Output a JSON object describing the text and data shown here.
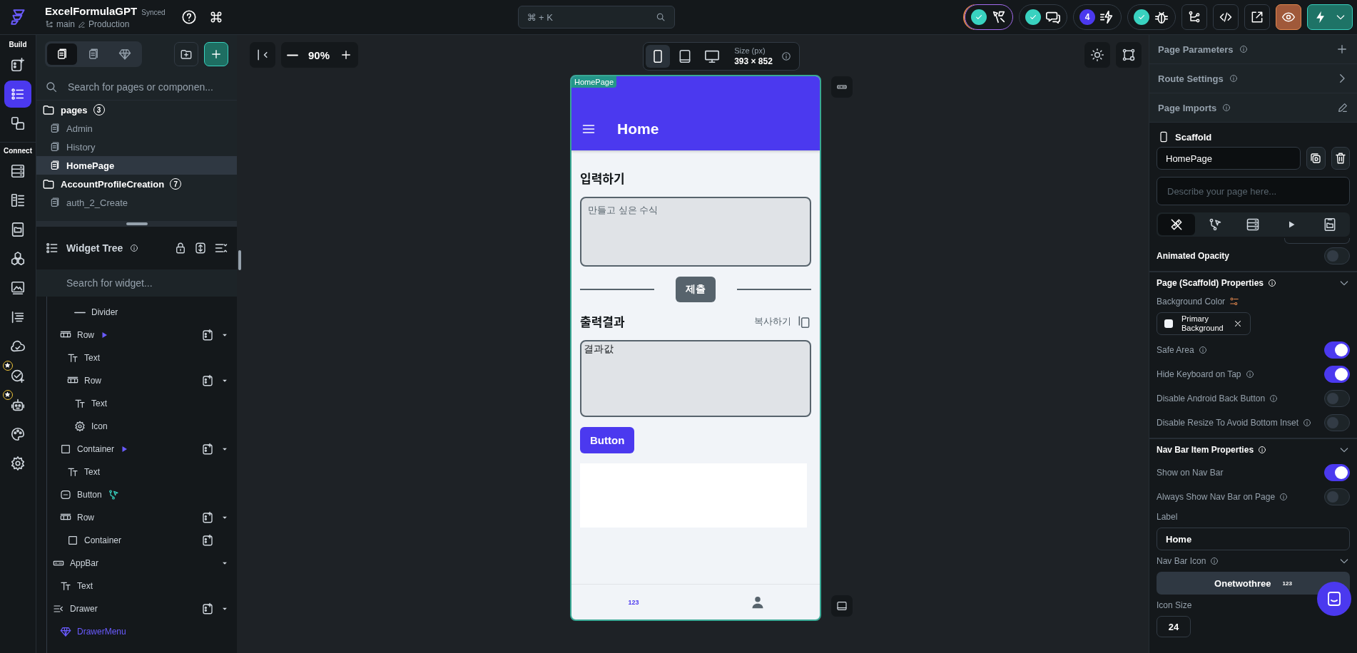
{
  "topbar": {
    "project": "ExcelFormulaGPT",
    "sync": "Synced",
    "branch": "main",
    "environment": "Production",
    "search": "⌘ + K",
    "status_pills": [
      {
        "kind": "check",
        "highlighted": true
      },
      {
        "kind": "check",
        "highlighted": false
      },
      {
        "kind": "count",
        "count": "4",
        "highlighted": false
      },
      {
        "kind": "check",
        "highlighted": false
      }
    ]
  },
  "rail": [
    {
      "label": "Build",
      "items": [
        {
          "selected": false,
          "starred": false
        },
        {
          "selected": true,
          "starred": false
        },
        {
          "selected": false,
          "starred": false
        }
      ]
    },
    {
      "label": "Connect",
      "items": [
        {
          "selected": false,
          "starred": false
        },
        {
          "selected": false,
          "starred": false
        },
        {
          "selected": false,
          "starred": false
        },
        {
          "selected": false,
          "starred": false
        },
        {
          "selected": false,
          "starred": false
        },
        {
          "selected": false,
          "starred": false
        },
        {
          "selected": false,
          "starred": false
        },
        {
          "selected": false,
          "starred": true
        },
        {
          "selected": false,
          "starred": true
        },
        {
          "selected": false,
          "starred": false
        },
        {
          "selected": false,
          "starred": false
        }
      ]
    }
  ],
  "pages_panel": {
    "tabs": [
      {
        "selected": true
      },
      {
        "selected": false
      },
      {
        "selected": false
      }
    ],
    "search": {
      "placeholder": "Search for pages or componen..."
    },
    "folders": [
      {
        "label": "pages",
        "count": "3",
        "children": [
          {
            "label": "Admin",
            "selected": false
          },
          {
            "label": "History",
            "selected": false
          },
          {
            "label": "HomePage",
            "selected": true
          }
        ]
      },
      {
        "label": "AccountProfileCreation",
        "count": "7",
        "children": [
          {
            "label": "auth_2_Create",
            "selected": false
          }
        ]
      }
    ]
  },
  "widget_tree": {
    "title": "Widget Tree",
    "search": {
      "placeholder": "Search for widget..."
    },
    "items": [
      {
        "children": [
          {
            "children": [
              {
                "children": [
                  {
                    "label": "Divider",
                    "kind": "divider",
                    "play": false,
                    "action": false,
                    "add": false,
                    "caret": false
                  }
                ]
              }
            ]
          },
          {
            "label": "Row",
            "kind": "row",
            "play": true,
            "action": false,
            "add": true,
            "caret": true,
            "children": [
              {
                "label": "Text",
                "kind": "text",
                "play": false,
                "action": false,
                "add": false,
                "caret": false
              },
              {
                "label": "Row",
                "kind": "row",
                "play": false,
                "action": false,
                "add": true,
                "caret": true,
                "children": [
                  {
                    "label": "Text",
                    "kind": "text",
                    "play": false,
                    "action": false,
                    "add": false,
                    "caret": false
                  },
                  {
                    "label": "Icon",
                    "kind": "icon",
                    "play": false,
                    "action": false,
                    "add": false,
                    "caret": false
                  }
                ]
              }
            ]
          },
          {
            "label": "Container",
            "kind": "container",
            "play": true,
            "action": false,
            "add": true,
            "caret": true,
            "children": [
              {
                "label": "Text",
                "kind": "text",
                "play": false,
                "action": false,
                "add": false,
                "caret": false
              }
            ]
          },
          {
            "label": "Button",
            "kind": "button",
            "play": false,
            "action": true,
            "add": false,
            "caret": false
          },
          {
            "label": "Row",
            "kind": "row",
            "play": false,
            "action": false,
            "add": true,
            "caret": true,
            "children": [
              {
                "label": "Container",
                "kind": "container",
                "play": false,
                "action": false,
                "add": true,
                "caret": false
              }
            ]
          }
        ]
      },
      {
        "label": "AppBar",
        "kind": "appbar",
        "play": false,
        "action": false,
        "add": false,
        "caret": true,
        "children": [
          {
            "label": "Text",
            "kind": "text",
            "play": false,
            "action": false,
            "add": false,
            "caret": false
          }
        ]
      },
      {
        "label": "Drawer",
        "kind": "drawer",
        "play": false,
        "action": false,
        "add": true,
        "caret": true,
        "children": [
          {
            "label": "DrawerMenu",
            "kind": "component",
            "play": false,
            "action": false,
            "add": false,
            "caret": false
          }
        ]
      }
    ]
  },
  "canvas": {
    "zoom": "90%",
    "devices": [
      {
        "selected": true
      },
      {
        "selected": false
      },
      {
        "selected": false
      }
    ],
    "size_label": "Size (px)",
    "size_value": "393 × 852",
    "phone": {
      "tag": "HomePage",
      "appbar_title": "Home",
      "input_label": "입력하기",
      "input_placeholder": "만들고 싶은 수식",
      "submit": "제출",
      "output_label": "출력결과",
      "copy": "복사하기",
      "result": "결과값",
      "button": "Button",
      "nav_items": [
        {
          "kind": "glyph",
          "glyph": "123",
          "selected": true
        },
        {
          "kind": "person",
          "selected": false
        }
      ]
    }
  },
  "properties": {
    "sections": [
      {
        "label": "Page Parameters",
        "kind": "add"
      },
      {
        "label": "Route Settings",
        "kind": "chevron"
      },
      {
        "label": "Page Imports",
        "kind": "edit"
      }
    ],
    "widget": "Scaffold",
    "name": "HomePage",
    "description": {
      "placeholder": "Describe your page here..."
    },
    "tabs": [
      {
        "selected": true
      },
      {
        "selected": false
      },
      {
        "selected": false
      },
      {
        "selected": false
      },
      {
        "selected": false
      }
    ],
    "animated_opacity": {
      "label": "Animated Opacity",
      "on": false
    },
    "scaffold": {
      "title": "Page (Scaffold) Properties",
      "bg_label": "Background Color",
      "bg_value": "Primary Background",
      "toggles": [
        {
          "label": "Safe Area",
          "info": true,
          "on": true
        },
        {
          "label": "Hide Keyboard on Tap",
          "info": true,
          "on": true
        },
        {
          "label": "Disable Android Back Button",
          "info": true,
          "on": false
        },
        {
          "label": "Disable Resize To Avoid Bottom Inset",
          "info": true,
          "on": false
        }
      ]
    },
    "navbar": {
      "title": "Nav Bar Item Properties",
      "toggles": [
        {
          "label": "Show on Nav Bar",
          "info": false,
          "on": true
        },
        {
          "label": "Always Show Nav Bar on Page",
          "info": true,
          "on": false
        }
      ],
      "label_caption": "Label",
      "label_value": "Home",
      "icon_caption": "Nav Bar Icon",
      "icon_value": "Onetwothree",
      "icon_glyph": "123",
      "size_caption": "Icon Size",
      "size_value": "24"
    }
  }
}
